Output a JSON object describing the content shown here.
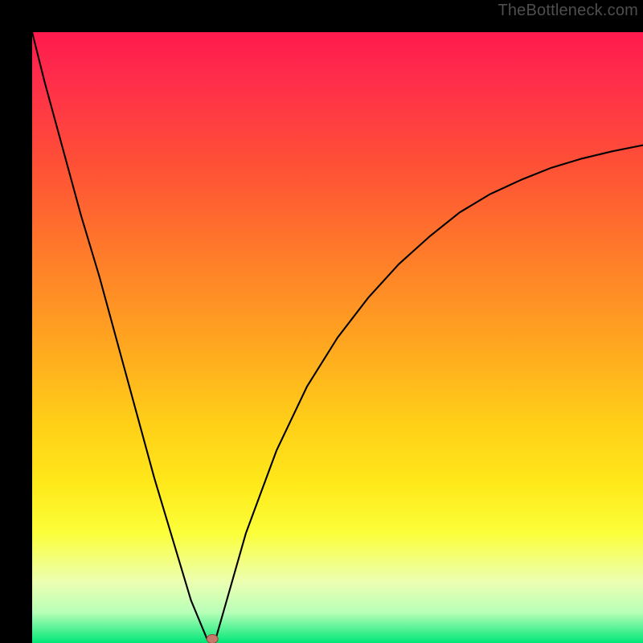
{
  "watermark": "TheBottleneck.com",
  "chart_data": {
    "type": "line",
    "title": "",
    "xlabel": "",
    "ylabel": "",
    "x": [
      0.0,
      0.02,
      0.05,
      0.08,
      0.11,
      0.14,
      0.17,
      0.2,
      0.23,
      0.26,
      0.287,
      0.3,
      0.31,
      0.33,
      0.35,
      0.4,
      0.45,
      0.5,
      0.55,
      0.6,
      0.65,
      0.7,
      0.75,
      0.8,
      0.85,
      0.9,
      0.95,
      1.0
    ],
    "values": [
      1.0,
      0.92,
      0.81,
      0.7,
      0.6,
      0.49,
      0.38,
      0.27,
      0.17,
      0.07,
      0.005,
      0.005,
      0.04,
      0.11,
      0.18,
      0.315,
      0.42,
      0.5,
      0.565,
      0.62,
      0.665,
      0.705,
      0.735,
      0.758,
      0.778,
      0.793,
      0.805,
      0.815
    ],
    "xlim": [
      0,
      1
    ],
    "ylim": [
      0,
      1
    ],
    "background_gradient_from": "#ff1a4d",
    "background_gradient_to": "#00e676",
    "curve_color": "#000000",
    "minimum_x": 0.295,
    "marker_color": "#c77a6a"
  }
}
